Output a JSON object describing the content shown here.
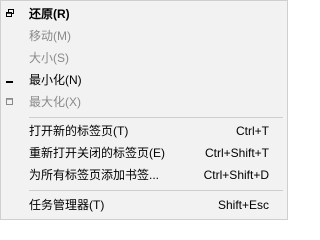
{
  "menu": {
    "items": [
      {
        "label": "还原(R)",
        "icon": "restore-window-icon",
        "bold": true,
        "enabled": true
      },
      {
        "label": "移动(M)",
        "enabled": false
      },
      {
        "label": "大小(S)",
        "enabled": false
      },
      {
        "label": "最小化(N)",
        "icon": "minimize-icon",
        "enabled": true
      },
      {
        "label": "最大化(X)",
        "icon": "maximize-icon",
        "enabled": false
      }
    ],
    "tab_items": [
      {
        "label": "打开新的标签页(T)",
        "shortcut": "Ctrl+T"
      },
      {
        "label": "重新打开关闭的标签页(E)",
        "shortcut": "Ctrl+Shift+T"
      },
      {
        "label": "为所有标签页添加书签...",
        "shortcut": "Ctrl+Shift+D"
      }
    ],
    "task_manager": {
      "label": "任务管理器(T)",
      "shortcut": "Shift+Esc"
    }
  },
  "colors": {
    "background": "#f2f2f2",
    "disabled_text": "#8a8a8a",
    "separator": "#cfcfcf"
  }
}
